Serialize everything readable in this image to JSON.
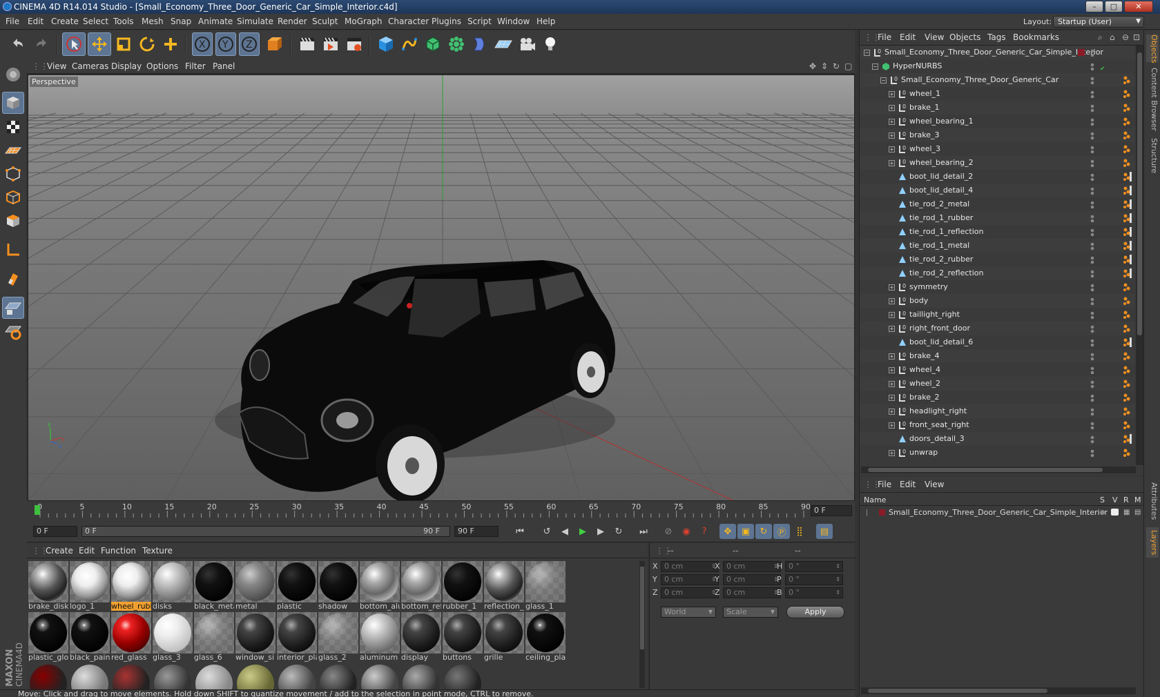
{
  "window": {
    "title": "CINEMA 4D R14.014 Studio - [Small_Economy_Three_Door_Generic_Car_Simple_Interior.c4d]",
    "minimize": "–",
    "maximize": "□",
    "close": "✕"
  },
  "menu": {
    "items": [
      "File",
      "Edit",
      "Create",
      "Select",
      "Tools",
      "Mesh",
      "Snap",
      "Animate",
      "Simulate",
      "Render",
      "Sculpt",
      "MoGraph",
      "Character",
      "Plugins",
      "Script",
      "Window",
      "Help"
    ],
    "layout_label": "Layout:",
    "layout_value": "Startup (User)"
  },
  "toolbar": {
    "icons": [
      "undo-icon",
      "redo-icon",
      "live-selection-icon",
      "move-icon",
      "scale-icon",
      "rotate-icon",
      "add-icon",
      "x-axis-icon",
      "y-axis-icon",
      "z-axis-icon",
      "coordinate-system-icon",
      "render-view-icon",
      "render-picture-viewer-icon",
      "edit-render-settings-icon",
      "cube-icon",
      "spline-pen-icon",
      "subdivision-surface-icon",
      "cloner-icon",
      "deformer-icon",
      "floor-icon",
      "camera-icon",
      "light-icon"
    ]
  },
  "viewport": {
    "menu": [
      "View",
      "Cameras",
      "Display",
      "Options",
      "Filter",
      "Panel"
    ],
    "label": "Perspective"
  },
  "timeline": {
    "ticks": [
      "0",
      "5",
      "10",
      "15",
      "20",
      "25",
      "30",
      "35",
      "40",
      "45",
      "50",
      "55",
      "60",
      "65",
      "70",
      "75",
      "80",
      "85",
      "90"
    ],
    "current_frame": "0 F"
  },
  "transport": {
    "start": "0 F",
    "range_start": "0 F",
    "range_end": "90 F",
    "end": "90 F"
  },
  "materials": {
    "menu": [
      "Create",
      "Edit",
      "Function",
      "Texture"
    ],
    "row1": [
      {
        "name": "brake_disk",
        "style": "chrome-env"
      },
      {
        "name": "logo_1",
        "style": "white-logo"
      },
      {
        "name": "wheel_rubl",
        "style": "white-logo",
        "selected": true
      },
      {
        "name": "disks",
        "style": "silver"
      },
      {
        "name": "black_meta",
        "style": "black"
      },
      {
        "name": "metal",
        "style": "grey"
      },
      {
        "name": "plastic",
        "style": "black"
      },
      {
        "name": "shadow",
        "style": "black"
      },
      {
        "name": "bottom_alu",
        "style": "chrome"
      },
      {
        "name": "bottom_ref",
        "style": "chrome"
      },
      {
        "name": "rubber_1",
        "style": "black"
      },
      {
        "name": "reflection_",
        "style": "chrome-env"
      },
      {
        "name": "glass_1",
        "style": "glass"
      }
    ],
    "row2": [
      {
        "name": "plastic_glo",
        "style": "black-gloss"
      },
      {
        "name": "black_pain",
        "style": "black-gloss"
      },
      {
        "name": "red_glass",
        "style": "red"
      },
      {
        "name": "glass_3",
        "style": "white"
      },
      {
        "name": "glass_6",
        "style": "glass"
      },
      {
        "name": "window_si",
        "style": "dark-texture"
      },
      {
        "name": "interior_pla",
        "style": "dark-texture"
      },
      {
        "name": "glass_2",
        "style": "glass"
      },
      {
        "name": "aluminum",
        "style": "silver"
      },
      {
        "name": "display",
        "style": "dark-texture"
      },
      {
        "name": "buttons",
        "style": "dark-texture"
      },
      {
        "name": "grille",
        "style": "dark-texture"
      },
      {
        "name": "ceiling_pla",
        "style": "black-gloss"
      }
    ]
  },
  "attributes": {
    "header": [
      "--",
      "--",
      "--"
    ],
    "rows": [
      {
        "a": "X",
        "av": "0 cm",
        "b": "X",
        "bv": "0 cm",
        "c": "H",
        "cv": "0 °"
      },
      {
        "a": "Y",
        "av": "0 cm",
        "b": "Y",
        "bv": "0 cm",
        "c": "P",
        "cv": "0 °"
      },
      {
        "a": "Z",
        "av": "0 cm",
        "b": "Z",
        "bv": "0 cm",
        "c": "B",
        "cv": "0 °"
      }
    ],
    "world": "World",
    "scale": "Scale",
    "apply": "Apply"
  },
  "status": "Move: Click and drag to move elements. Hold down SHIFT to quantize movement / add to the selection in point mode, CTRL to remove.",
  "objects": {
    "menu": [
      "File",
      "Edit",
      "View",
      "Objects",
      "Tags",
      "Bookmarks"
    ],
    "tree": [
      {
        "name": "Small_Economy_Three_Door_Generic_Car_Simple_Interior",
        "type": "null",
        "depth": 0
      },
      {
        "name": "HyperNURBS",
        "type": "nurbs",
        "depth": 1
      },
      {
        "name": "Small_Economy_Three_Door_Generic_Car",
        "type": "null",
        "depth": 2
      },
      {
        "name": "wheel_1",
        "type": "null",
        "depth": 3
      },
      {
        "name": "brake_1",
        "type": "null",
        "depth": 3
      },
      {
        "name": "wheel_bearing_1",
        "type": "null",
        "depth": 3
      },
      {
        "name": "brake_3",
        "type": "null",
        "depth": 3
      },
      {
        "name": "wheel_3",
        "type": "null",
        "depth": 3
      },
      {
        "name": "wheel_bearing_2",
        "type": "null",
        "depth": 3
      },
      {
        "name": "boot_lid_detail_2",
        "type": "poly",
        "depth": 3
      },
      {
        "name": "boot_lid_detail_4",
        "type": "poly",
        "depth": 3
      },
      {
        "name": "tie_rod_2_metal",
        "type": "poly",
        "depth": 3
      },
      {
        "name": "tie_rod_1_rubber",
        "type": "poly",
        "depth": 3
      },
      {
        "name": "tie_rod_1_reflection",
        "type": "poly",
        "depth": 3
      },
      {
        "name": "tie_rod_1_metal",
        "type": "poly",
        "depth": 3
      },
      {
        "name": "tie_rod_2_rubber",
        "type": "poly",
        "depth": 3
      },
      {
        "name": "tie_rod_2_reflection",
        "type": "poly",
        "depth": 3
      },
      {
        "name": "symmetry",
        "type": "null",
        "depth": 3
      },
      {
        "name": "body",
        "type": "null",
        "depth": 3
      },
      {
        "name": "taillight_right",
        "type": "null",
        "depth": 3
      },
      {
        "name": "right_front_door",
        "type": "null",
        "depth": 3
      },
      {
        "name": "boot_lid_detail_6",
        "type": "poly",
        "depth": 3
      },
      {
        "name": "brake_4",
        "type": "null",
        "depth": 3
      },
      {
        "name": "wheel_4",
        "type": "null",
        "depth": 3
      },
      {
        "name": "wheel_2",
        "type": "null",
        "depth": 3
      },
      {
        "name": "brake_2",
        "type": "null",
        "depth": 3
      },
      {
        "name": "headlight_right",
        "type": "null",
        "depth": 3
      },
      {
        "name": "front_seat_right",
        "type": "null",
        "depth": 3
      },
      {
        "name": "doors_detail_3",
        "type": "poly",
        "depth": 3
      },
      {
        "name": "unwrap",
        "type": "null",
        "depth": 3
      }
    ]
  },
  "layers": {
    "menu": [
      "File",
      "Edit",
      "View"
    ],
    "col_name": "Name",
    "cols": [
      "S",
      "V",
      "R",
      "M"
    ],
    "rows": [
      {
        "name": "Small_Economy_Three_Door_Generic_Car_Simple_Interior"
      }
    ]
  },
  "side_tabs": [
    "Objects",
    "Content Browser",
    "Structure",
    "Attributes",
    "Layers"
  ],
  "colors": {
    "accent": "#f0a030",
    "active": "#5d7592",
    "layer": "#8a1c2a"
  }
}
